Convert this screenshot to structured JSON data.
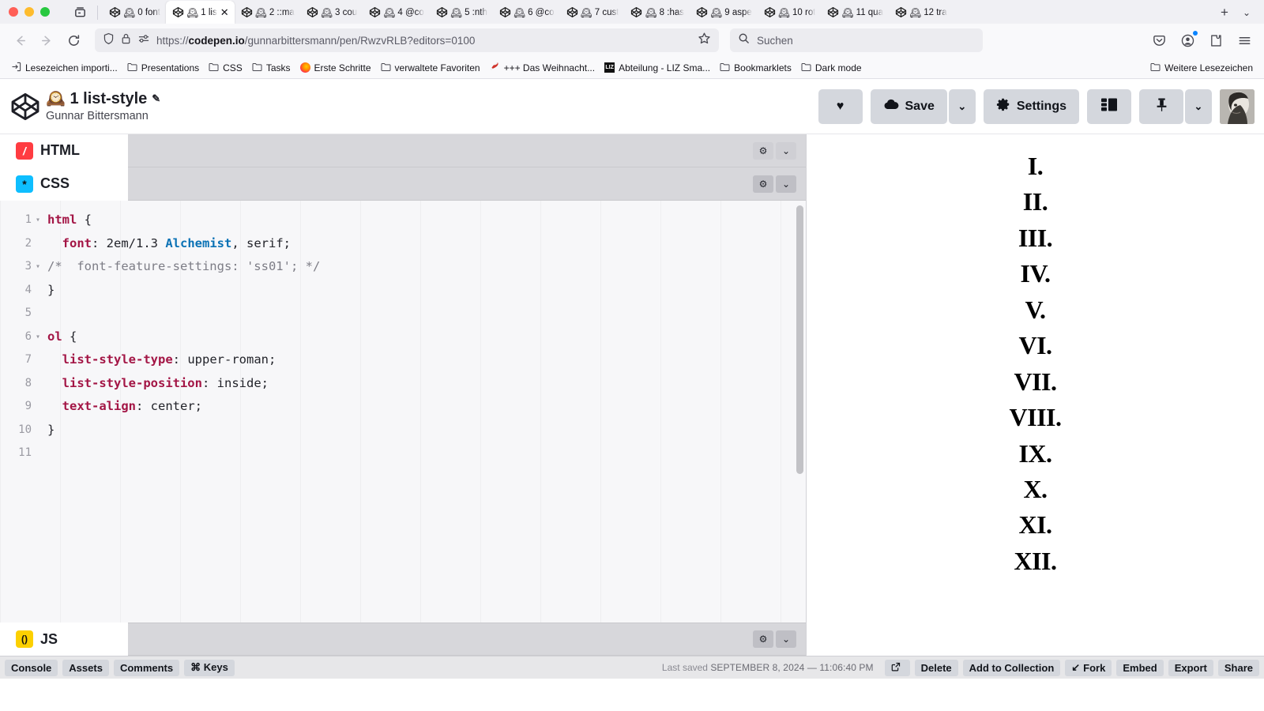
{
  "browser": {
    "window_controls": [
      "close",
      "minimize",
      "zoom"
    ],
    "sidebar_button": "firefox-view",
    "tabs": [
      {
        "label": "0 font",
        "active": false
      },
      {
        "label": "1 lis",
        "active": true
      },
      {
        "label": "2 ::ma",
        "active": false
      },
      {
        "label": "3 cou",
        "active": false
      },
      {
        "label": "4 @co",
        "active": false
      },
      {
        "label": "5 :nth",
        "active": false
      },
      {
        "label": "6 @co",
        "active": false
      },
      {
        "label": "7 cust",
        "active": false
      },
      {
        "label": "8 :has",
        "active": false
      },
      {
        "label": "9 aspe",
        "active": false
      },
      {
        "label": "10 rot",
        "active": false
      },
      {
        "label": "11 qua",
        "active": false
      },
      {
        "label": "12 tra",
        "active": false
      }
    ],
    "new_tab_label": "+",
    "tab_list_label": "⌄",
    "nav": {
      "back": "←",
      "forward": "→",
      "reload": "↻",
      "url_scheme": "https://",
      "url_host": "codepen.io",
      "url_path": "/gunnarbittersmann/pen/RwzvRLB?editors=0100",
      "bookmark_star": "☆"
    },
    "search": {
      "placeholder": "Suchen",
      "icon": "search-icon"
    },
    "toolbar_right": [
      "pocket-icon",
      "account-icon",
      "extensions-icon",
      "menu-icon"
    ],
    "bookmarks": [
      {
        "label": "Lesezeichen importi...",
        "icon": "import-icon"
      },
      {
        "label": "Presentations",
        "icon": "folder-icon"
      },
      {
        "label": "CSS",
        "icon": "folder-icon"
      },
      {
        "label": "Tasks",
        "icon": "folder-icon"
      },
      {
        "label": "Erste Schritte",
        "icon": "firefox-icon"
      },
      {
        "label": "verwaltete Favoriten",
        "icon": "folder-icon"
      },
      {
        "label": "+++ Das Weihnacht...",
        "icon": "santa-icon"
      },
      {
        "label": "Abteilung - LIZ Sma...",
        "icon": "liz-icon"
      },
      {
        "label": "Bookmarklets",
        "icon": "folder-icon"
      },
      {
        "label": "Dark mode",
        "icon": "folder-icon"
      }
    ],
    "bookmarks_more": {
      "label": "Weitere Lesezeichen",
      "icon": "folder-icon"
    }
  },
  "codepen": {
    "logo": "codepen-logo",
    "pen_title": "🕰️ 1 list-style",
    "pen_title_edit_icon": "✎",
    "author": "Gunnar Bittersmann",
    "actions": {
      "love_label": "♥",
      "save_label": "Save",
      "save_caret": "⌄",
      "settings_label": "Settings",
      "layout_label": "layout-icon",
      "pin_label": "pin-icon",
      "pin_caret": "⌄",
      "avatar_label": "user-avatar"
    },
    "panes": [
      {
        "id": "html",
        "label": "HTML",
        "badge": "/",
        "collapsed": true
      },
      {
        "id": "css",
        "label": "CSS",
        "badge": "*",
        "collapsed": false
      },
      {
        "id": "js",
        "label": "JS",
        "badge": "()",
        "collapsed": true
      }
    ],
    "css_code": {
      "lines": [
        {
          "num": "1",
          "fold": "▾",
          "tokens": [
            {
              "t": "sel",
              "v": "html"
            },
            {
              "t": "punc",
              "v": " {"
            }
          ]
        },
        {
          "num": "2",
          "fold": "",
          "tokens": [
            {
              "t": "punc",
              "v": "  "
            },
            {
              "t": "prop",
              "v": "font"
            },
            {
              "t": "punc",
              "v": ": "
            },
            {
              "t": "val",
              "v": "2em/1.3 "
            },
            {
              "t": "fn",
              "v": "Alchemist"
            },
            {
              "t": "punc",
              "v": ", "
            },
            {
              "t": "val",
              "v": "serif;"
            }
          ]
        },
        {
          "num": "3",
          "fold": "▾",
          "tokens": [
            {
              "t": "com",
              "v": "/*  font-feature-settings: 'ss01'; */"
            }
          ]
        },
        {
          "num": "4",
          "fold": "",
          "tokens": [
            {
              "t": "punc",
              "v": "}"
            }
          ]
        },
        {
          "num": "5",
          "fold": "",
          "tokens": []
        },
        {
          "num": "6",
          "fold": "▾",
          "tokens": [
            {
              "t": "sel",
              "v": "ol"
            },
            {
              "t": "punc",
              "v": " {"
            }
          ]
        },
        {
          "num": "7",
          "fold": "",
          "tokens": [
            {
              "t": "punc",
              "v": "  "
            },
            {
              "t": "prop",
              "v": "list-style-type"
            },
            {
              "t": "punc",
              "v": ": "
            },
            {
              "t": "val",
              "v": "upper-roman;"
            }
          ]
        },
        {
          "num": "8",
          "fold": "",
          "tokens": [
            {
              "t": "punc",
              "v": "  "
            },
            {
              "t": "prop",
              "v": "list-style-position"
            },
            {
              "t": "punc",
              "v": ": "
            },
            {
              "t": "val",
              "v": "inside;"
            }
          ]
        },
        {
          "num": "9",
          "fold": "",
          "tokens": [
            {
              "t": "punc",
              "v": "  "
            },
            {
              "t": "prop",
              "v": "text-align"
            },
            {
              "t": "punc",
              "v": ": "
            },
            {
              "t": "val",
              "v": "center;"
            }
          ]
        },
        {
          "num": "10",
          "fold": "",
          "tokens": [
            {
              "t": "punc",
              "v": "}"
            }
          ]
        },
        {
          "num": "11",
          "fold": "",
          "tokens": []
        }
      ]
    },
    "preview": {
      "list_items": [
        "I.",
        "II.",
        "III.",
        "IV.",
        "V.",
        "VI.",
        "VII.",
        "VIII.",
        "IX.",
        "X.",
        "XI.",
        "XII."
      ]
    },
    "bottom_bar": {
      "left_buttons": [
        {
          "label": "Console"
        },
        {
          "label": "Assets"
        },
        {
          "label": "Comments"
        },
        {
          "label": "⌘ Keys"
        }
      ],
      "saved_prefix": "Last saved",
      "saved_date": "SEPTEMBER 8, 2024 — 11:06:40 PM",
      "right_buttons": [
        {
          "label": "",
          "icon": "open-external-icon"
        },
        {
          "label": "Delete",
          "icon": ""
        },
        {
          "label": "Add to Collection",
          "icon": ""
        },
        {
          "label": "Fork",
          "icon": "↙"
        },
        {
          "label": "Embed",
          "icon": ""
        },
        {
          "label": "Export",
          "icon": ""
        },
        {
          "label": "Share",
          "icon": ""
        }
      ]
    }
  },
  "colors": {
    "chrome_bg": "#f0f0f4",
    "nav_bg": "#f9f9fb",
    "codepen_btn": "#d4d7dd",
    "pane_head": "#d7d7db",
    "code_bg": "#f7f7f9",
    "selector": "#a31545",
    "function": "#0b72b5",
    "comment": "#7d7d86",
    "html_badge": "#ff3c41",
    "css_badge": "#0ebeff",
    "js_badge": "#fcd000"
  }
}
